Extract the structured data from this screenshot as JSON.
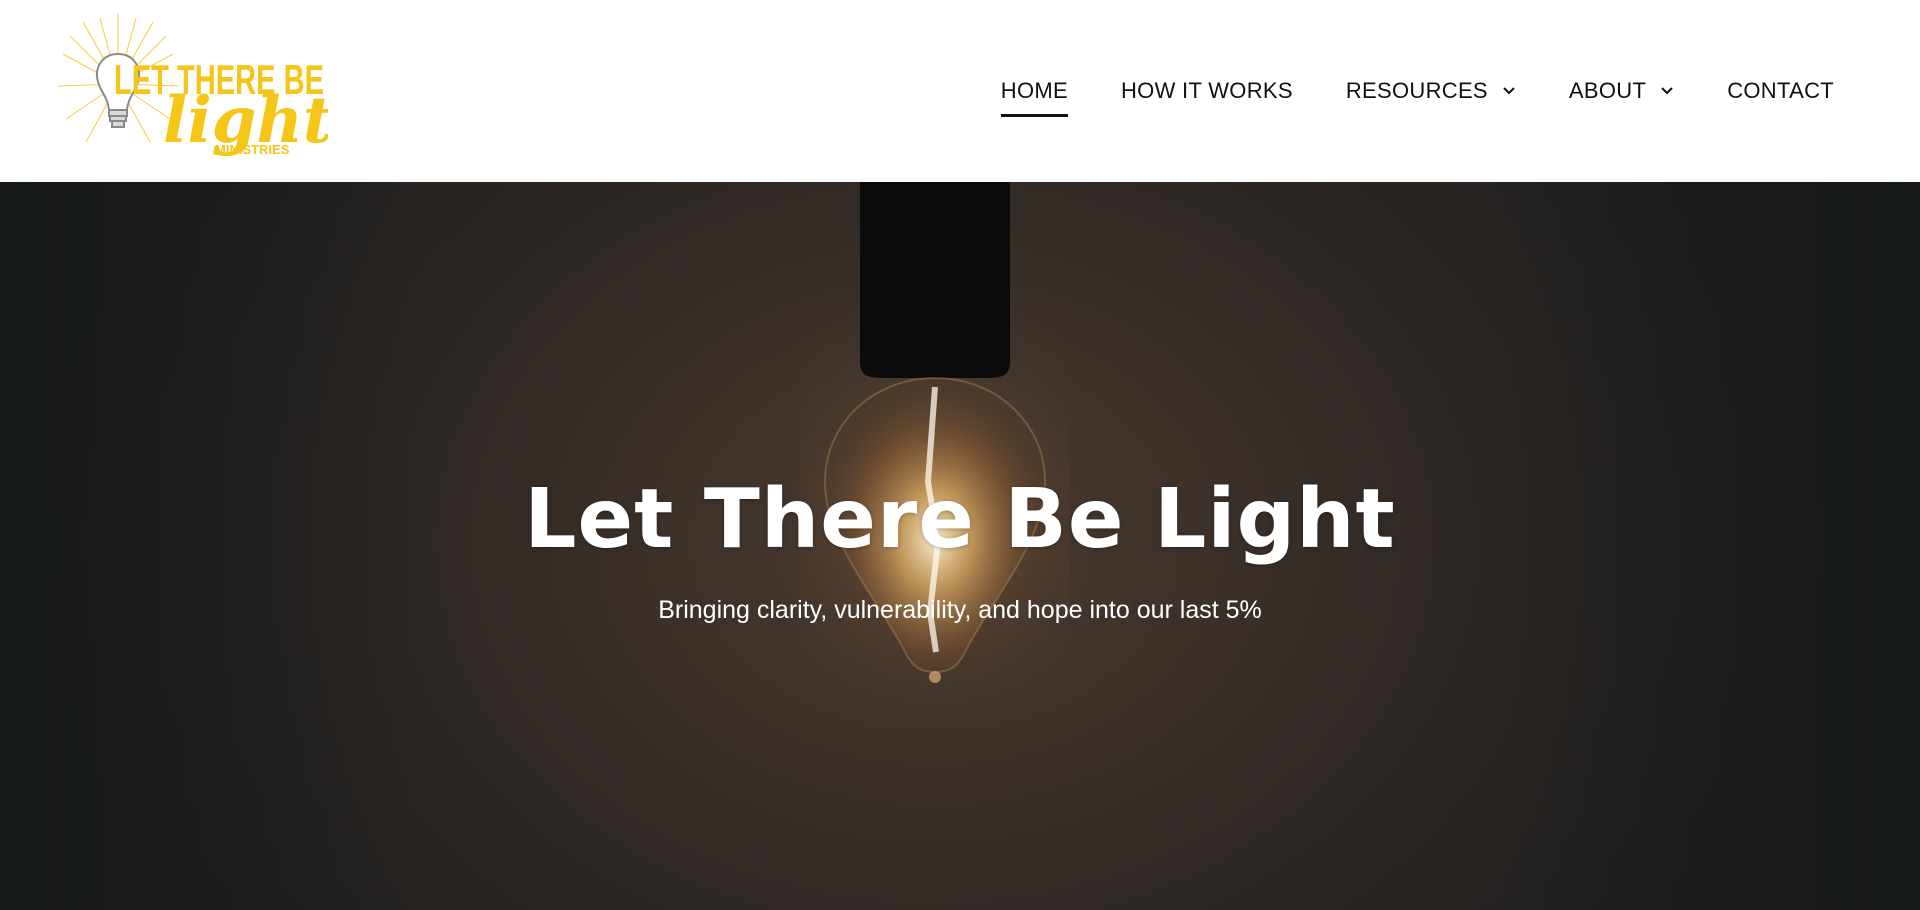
{
  "logo": {
    "line1": "LET THERE BE",
    "line2": "light",
    "line3": "MINISTRIES",
    "icon": "lightbulb-burst-icon",
    "color": "#f5c518"
  },
  "nav": {
    "items": [
      {
        "label": "HOME",
        "active": true,
        "dropdown": false
      },
      {
        "label": "HOW IT WORKS",
        "active": false,
        "dropdown": false
      },
      {
        "label": "RESOURCES",
        "active": false,
        "dropdown": true,
        "icon": "chevron-down-icon"
      },
      {
        "label": "ABOUT",
        "active": false,
        "dropdown": true,
        "icon": "chevron-down-icon"
      },
      {
        "label": "CONTACT",
        "active": false,
        "dropdown": false
      }
    ]
  },
  "hero": {
    "title": "Let There Be Light",
    "subtitle": "Bringing clarity, vulnerability, and hope into our last 5%",
    "background": "hanging-lightbulb-photo",
    "text_color": "#ffffff"
  }
}
